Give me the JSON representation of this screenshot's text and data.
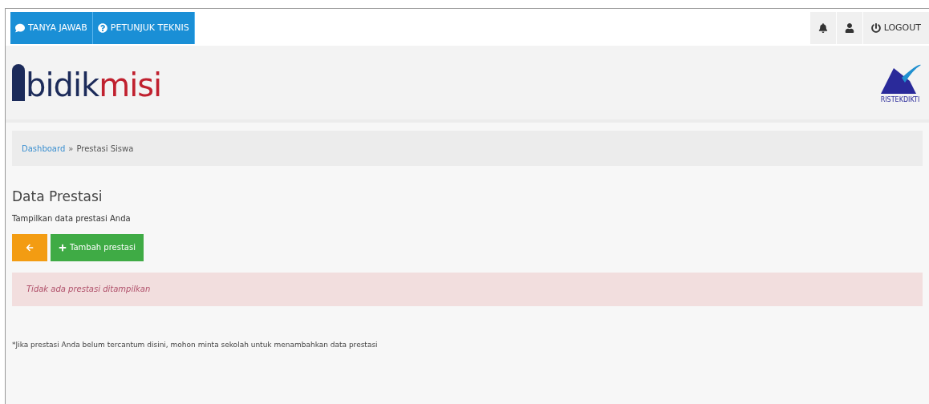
{
  "topbar": {
    "left_buttons": [
      {
        "kind": "chat",
        "label": "TANYA JAWAB"
      },
      {
        "kind": "help",
        "label": "PETUNJUK TEKNIS"
      }
    ],
    "right_buttons": [
      {
        "kind": "bell"
      },
      {
        "kind": "user"
      },
      {
        "kind": "power",
        "label": "LOGOUT"
      }
    ]
  },
  "header": {
    "logo_dark": "bidik",
    "logo_red": "misi",
    "ministry_logo": "RISTEKDIKTI"
  },
  "breadcrumb": {
    "link": "Dashboard",
    "separator": "»",
    "current": "Prestasi Siswa"
  },
  "title": "Data Prestasi",
  "subtitle": "Tampilkan data prestasi Anda",
  "actions": [
    {
      "kind": "back"
    },
    {
      "kind": "add",
      "label": "Tambah prestasi"
    }
  ],
  "alert": "Tidak ada prestasi ditampilkan",
  "note": "*Jika prestasi Anda belum tercantum disini, mohon minta sekolah untuk menambahkan data prestasi"
}
